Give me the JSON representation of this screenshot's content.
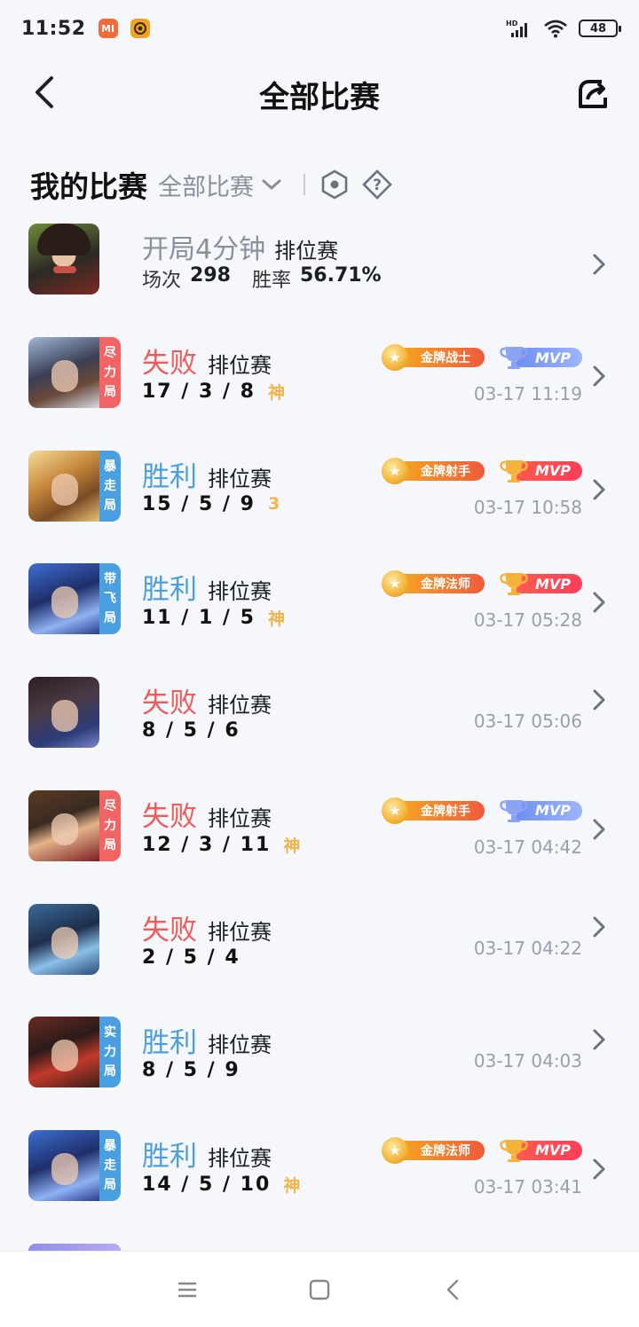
{
  "status_bar": {
    "time": "11:52",
    "app_icon_1": "MI",
    "battery": "48"
  },
  "nav": {
    "title": "全部比赛"
  },
  "section": {
    "title": "我的比赛",
    "filter_value": "全部比赛"
  },
  "summary": {
    "title": "开局4分钟",
    "mode": "排位赛",
    "games_label": "场次",
    "games_value": "298",
    "winrate_label": "胜率",
    "winrate_value": "56.71%"
  },
  "matches": [
    {
      "result": "失败",
      "mode": "排位赛",
      "kda": "17 / 3 / 8",
      "badge": "神",
      "tag": [
        "尽",
        "力",
        "局"
      ],
      "time": "03-17 11:19",
      "gold": "金牌战士",
      "mvp": "MVP"
    },
    {
      "result": "胜利",
      "mode": "排位赛",
      "kda": "15 / 5 / 9",
      "badge": "3",
      "tag": [
        "暴",
        "走",
        "局"
      ],
      "time": "03-17 10:58",
      "gold": "金牌射手",
      "mvp": "MVP"
    },
    {
      "result": "胜利",
      "mode": "排位赛",
      "kda": "11 / 1 / 5",
      "badge": "神",
      "tag": [
        "带",
        "飞",
        "局"
      ],
      "time": "03-17 05:28",
      "gold": "金牌法师",
      "mvp": "MVP"
    },
    {
      "result": "失败",
      "mode": "排位赛",
      "kda": "8 / 5 / 6",
      "time": "03-17 05:06"
    },
    {
      "result": "失败",
      "mode": "排位赛",
      "kda": "12 / 3 / 11",
      "badge": "神",
      "tag": [
        "尽",
        "力",
        "局"
      ],
      "time": "03-17 04:42",
      "gold": "金牌射手",
      "mvp": "MVP"
    },
    {
      "result": "失败",
      "mode": "排位赛",
      "kda": "2 / 5 / 4",
      "time": "03-17 04:22"
    },
    {
      "result": "胜利",
      "mode": "排位赛",
      "kda": "8 / 5 / 9",
      "tag": [
        "实",
        "力",
        "局"
      ],
      "time": "03-17 04:03"
    },
    {
      "result": "胜利",
      "mode": "排位赛",
      "kda": "14 / 5 / 10",
      "badge": "神",
      "tag": [
        "暴",
        "走",
        "局"
      ],
      "time": "03-17 03:41",
      "gold": "金牌法师",
      "mvp": "MVP"
    }
  ],
  "colors": {
    "win": "#4a9fe0",
    "loss": "#ef5a5a",
    "tag_red": "#f26363",
    "tag_blue": "#4a9fe0",
    "badge_gold": "#f2b34a"
  },
  "icons": {
    "back": "chevron-left-icon",
    "share": "share-icon",
    "filter": "chevron-down-icon",
    "hex": "hexagon-icon",
    "help": "question-diamond-icon",
    "row": "chevron-right-icon"
  }
}
